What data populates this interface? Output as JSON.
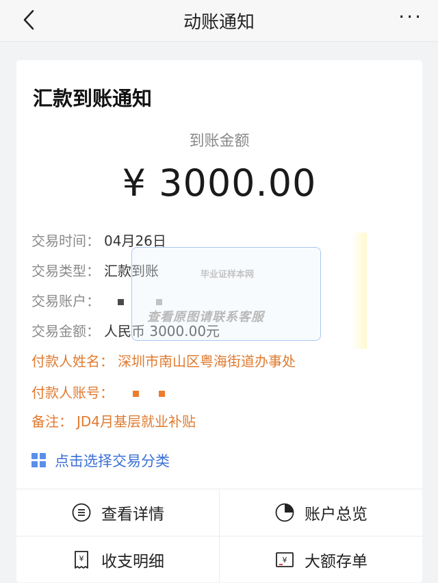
{
  "header": {
    "title": "动账通知"
  },
  "card": {
    "title": "汇款到账通知",
    "amount_label": "到账金额",
    "amount": "¥ 3000.00",
    "fields": [
      {
        "label": "交易时间：",
        "value": "04月26日"
      },
      {
        "label": "交易类型：",
        "value": "汇款到账"
      },
      {
        "label": "交易账户：",
        "value": ""
      },
      {
        "label": "交易金额：",
        "value": "人民币 3000.00元"
      },
      {
        "label": "付款人姓名：",
        "value": "深圳市南山区粤海街道办事处"
      },
      {
        "label": "付款人账号：",
        "value": ""
      },
      {
        "label": "备注：",
        "value": "JD4月基层就业补贴"
      }
    ],
    "category_link": "点击选择交易分类"
  },
  "watermark": {
    "logo_text": "毕业证样本网",
    "text": "查看原图请联系客服"
  },
  "actions": [
    {
      "label": "查看详情",
      "icon": "list-circle-icon"
    },
    {
      "label": "账户总览",
      "icon": "pie-chart-icon"
    },
    {
      "label": "收支明细",
      "icon": "receipt-yen-icon"
    },
    {
      "label": "大额存单",
      "icon": "deposit-yen-icon"
    }
  ],
  "colors": {
    "accent_orange": "#e07a2f",
    "link_blue": "#3a6fd6"
  }
}
